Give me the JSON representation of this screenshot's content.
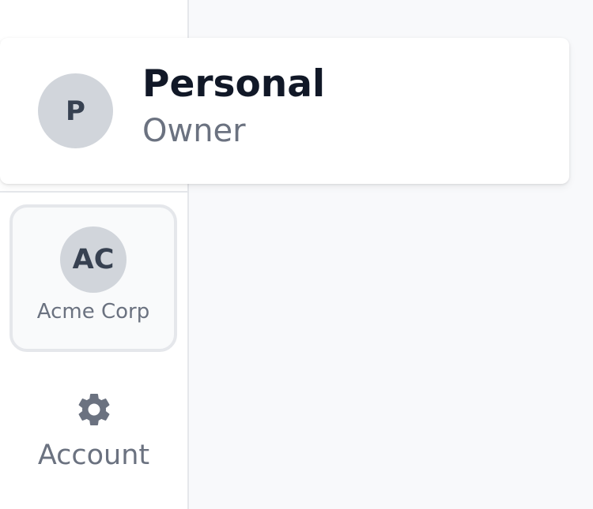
{
  "popover": {
    "avatar_initial": "P",
    "name": "Personal",
    "role": "Owner"
  },
  "sidebar": {
    "workspaces": [
      {
        "initials": "AC",
        "name": "Acme Corp",
        "selected": true
      }
    ],
    "account": {
      "icon": "gear-icon",
      "label": "Account"
    }
  },
  "colors": {
    "page_bg": "#f8f9fb",
    "sidebar_bg": "#ffffff",
    "border": "#e5e7eb",
    "avatar_bg": "#d1d5db",
    "avatar_text": "#374151",
    "title_text": "#111827",
    "muted_text": "#6b7280"
  }
}
